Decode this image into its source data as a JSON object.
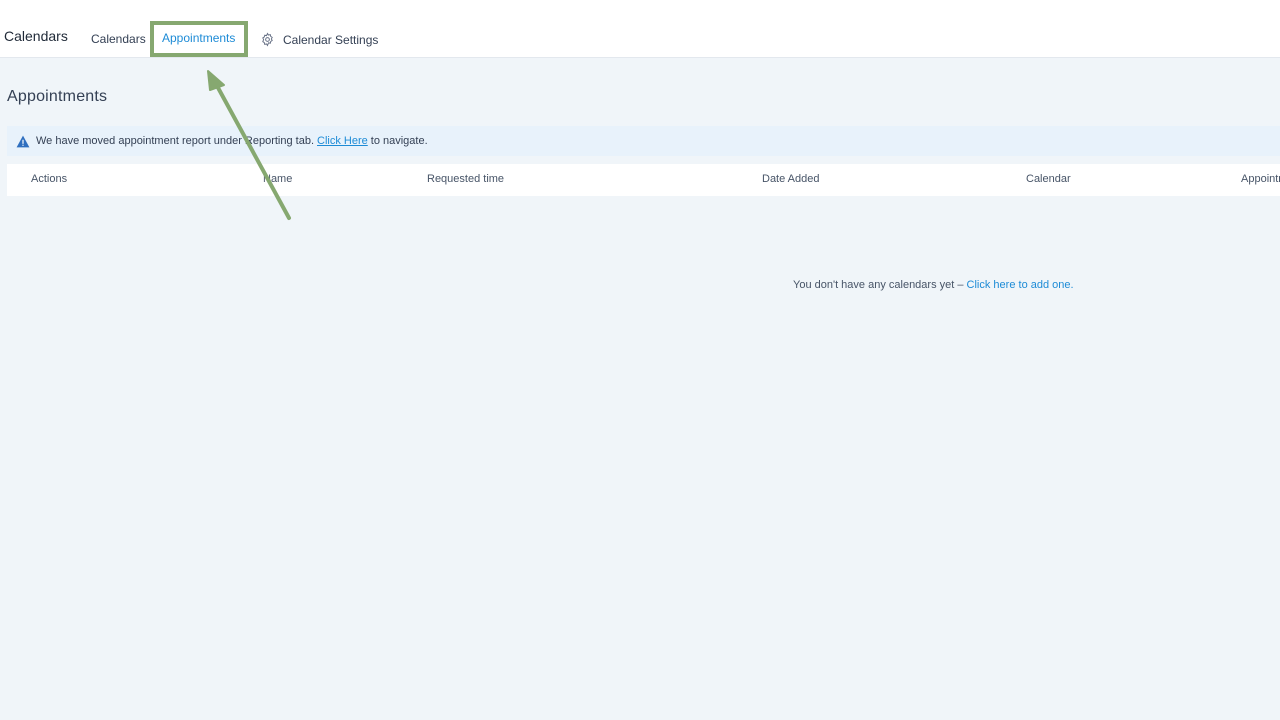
{
  "header": {
    "app_title": "Calendars",
    "tabs": [
      {
        "label": "Calendars",
        "active": false
      },
      {
        "label": "Appointments",
        "active": true
      },
      {
        "label": "Calendar Settings",
        "active": false,
        "icon": "gear-icon"
      }
    ]
  },
  "page": {
    "title": "Appointments"
  },
  "banner": {
    "icon": "warning-icon",
    "text_before": "We have moved appointment report under Reporting tab.",
    "link_label": "Click Here",
    "text_after": "to navigate."
  },
  "table": {
    "columns": [
      "Actions",
      "Name",
      "Requested time",
      "Date Added",
      "Calendar",
      "Appointment"
    ]
  },
  "empty_state": {
    "text": "You don't have any calendars yet – ",
    "link_label": "Click here to add one."
  },
  "annotation": {
    "highlight_color": "#86a870",
    "arrow_color": "#86a870"
  },
  "colors": {
    "accent": "#1d8bd6",
    "background": "#f0f5f9",
    "banner_background": "#e8f2fb",
    "warning_icon": "#2f6fbf"
  }
}
